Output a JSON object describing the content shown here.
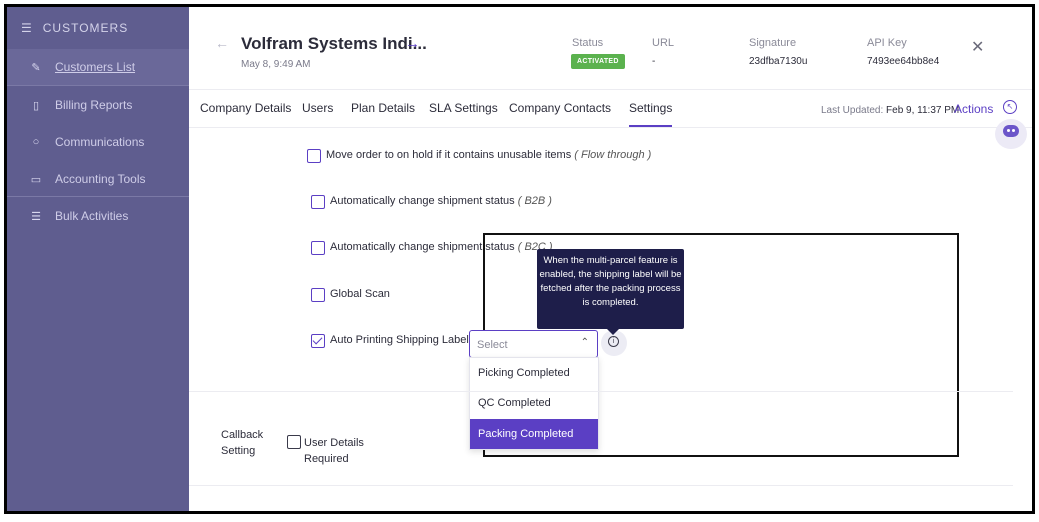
{
  "sidebar": {
    "header": "CUSTOMERS",
    "items": [
      {
        "label": "Customers List",
        "icon": "pencil-icon"
      },
      {
        "label": "Billing Reports",
        "icon": "clipboard-icon"
      },
      {
        "label": "Communications",
        "icon": "chat-icon"
      },
      {
        "label": "Accounting Tools",
        "icon": "ledger-icon"
      },
      {
        "label": "Bulk Activities",
        "icon": "list-icon"
      }
    ]
  },
  "header": {
    "title": "Volfram Systems Indi...",
    "date": "May 8, 9:49 AM",
    "status_label": "Status",
    "status_value": "ACTIVATED",
    "url_label": "URL",
    "url_value": "-",
    "signature_label": "Signature",
    "signature_value": "23dfba7130u",
    "api_key_label": "API Key",
    "api_key_value": "7493ee64bb8e4"
  },
  "tabs": [
    {
      "label": "Company Details"
    },
    {
      "label": "Users"
    },
    {
      "label": "Plan Details"
    },
    {
      "label": "SLA Settings"
    },
    {
      "label": "Company Contacts"
    },
    {
      "label": "Settings"
    }
  ],
  "last_updated_label": "Last Updated:",
  "last_updated_value": "Feb 9, 11:37 PM",
  "actions_label": "Actions",
  "settings": {
    "move_order": {
      "label": "Move order to on hold if it contains unusable items",
      "note": "( Flow through )",
      "checked": false
    },
    "change_b2b": {
      "label": "Automatically change shipment status",
      "note": "( B2B )",
      "checked": false
    },
    "change_b2c": {
      "label": "Automatically change shipment status",
      "note": "( B2C )",
      "checked": false
    },
    "global_scan": {
      "label": "Global Scan",
      "checked": false
    },
    "auto_print": {
      "label": "Auto Printing Shipping Label",
      "checked": true
    }
  },
  "select": {
    "placeholder": "Select",
    "options": [
      "Picking Completed",
      "QC Completed",
      "Packing Completed"
    ],
    "selected": "Packing Completed"
  },
  "tooltip": "When the multi-parcel feature is enabled, the shipping label will be fetched after the packing process is completed.",
  "callback": {
    "label_line1": "Callback",
    "label_line2": "Setting",
    "user_details_line1": "User Details",
    "user_details_line2": "Required"
  },
  "colors": {
    "accent": "#5b3fc4",
    "sidebar": "#5f5d8f",
    "badge": "#5bb24e",
    "tooltip": "#1e1e4a"
  }
}
